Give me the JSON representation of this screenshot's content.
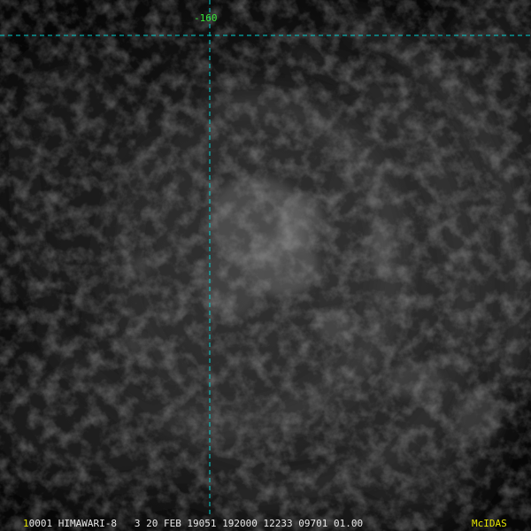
{
  "colors": {
    "background": "#050505",
    "grid_line": "#00d2d2",
    "longitude_label": "#39e639",
    "footer_text": "#e8e8e8",
    "footer_accent": "#e6e600"
  },
  "grid": {
    "longitude_label": "-160"
  },
  "footer": {
    "frame_number": "1",
    "text": "0001 HIMAWARI-8   3 20 FEB 19051 192000 12233 09701 01.00",
    "brand": "McIDAS"
  }
}
